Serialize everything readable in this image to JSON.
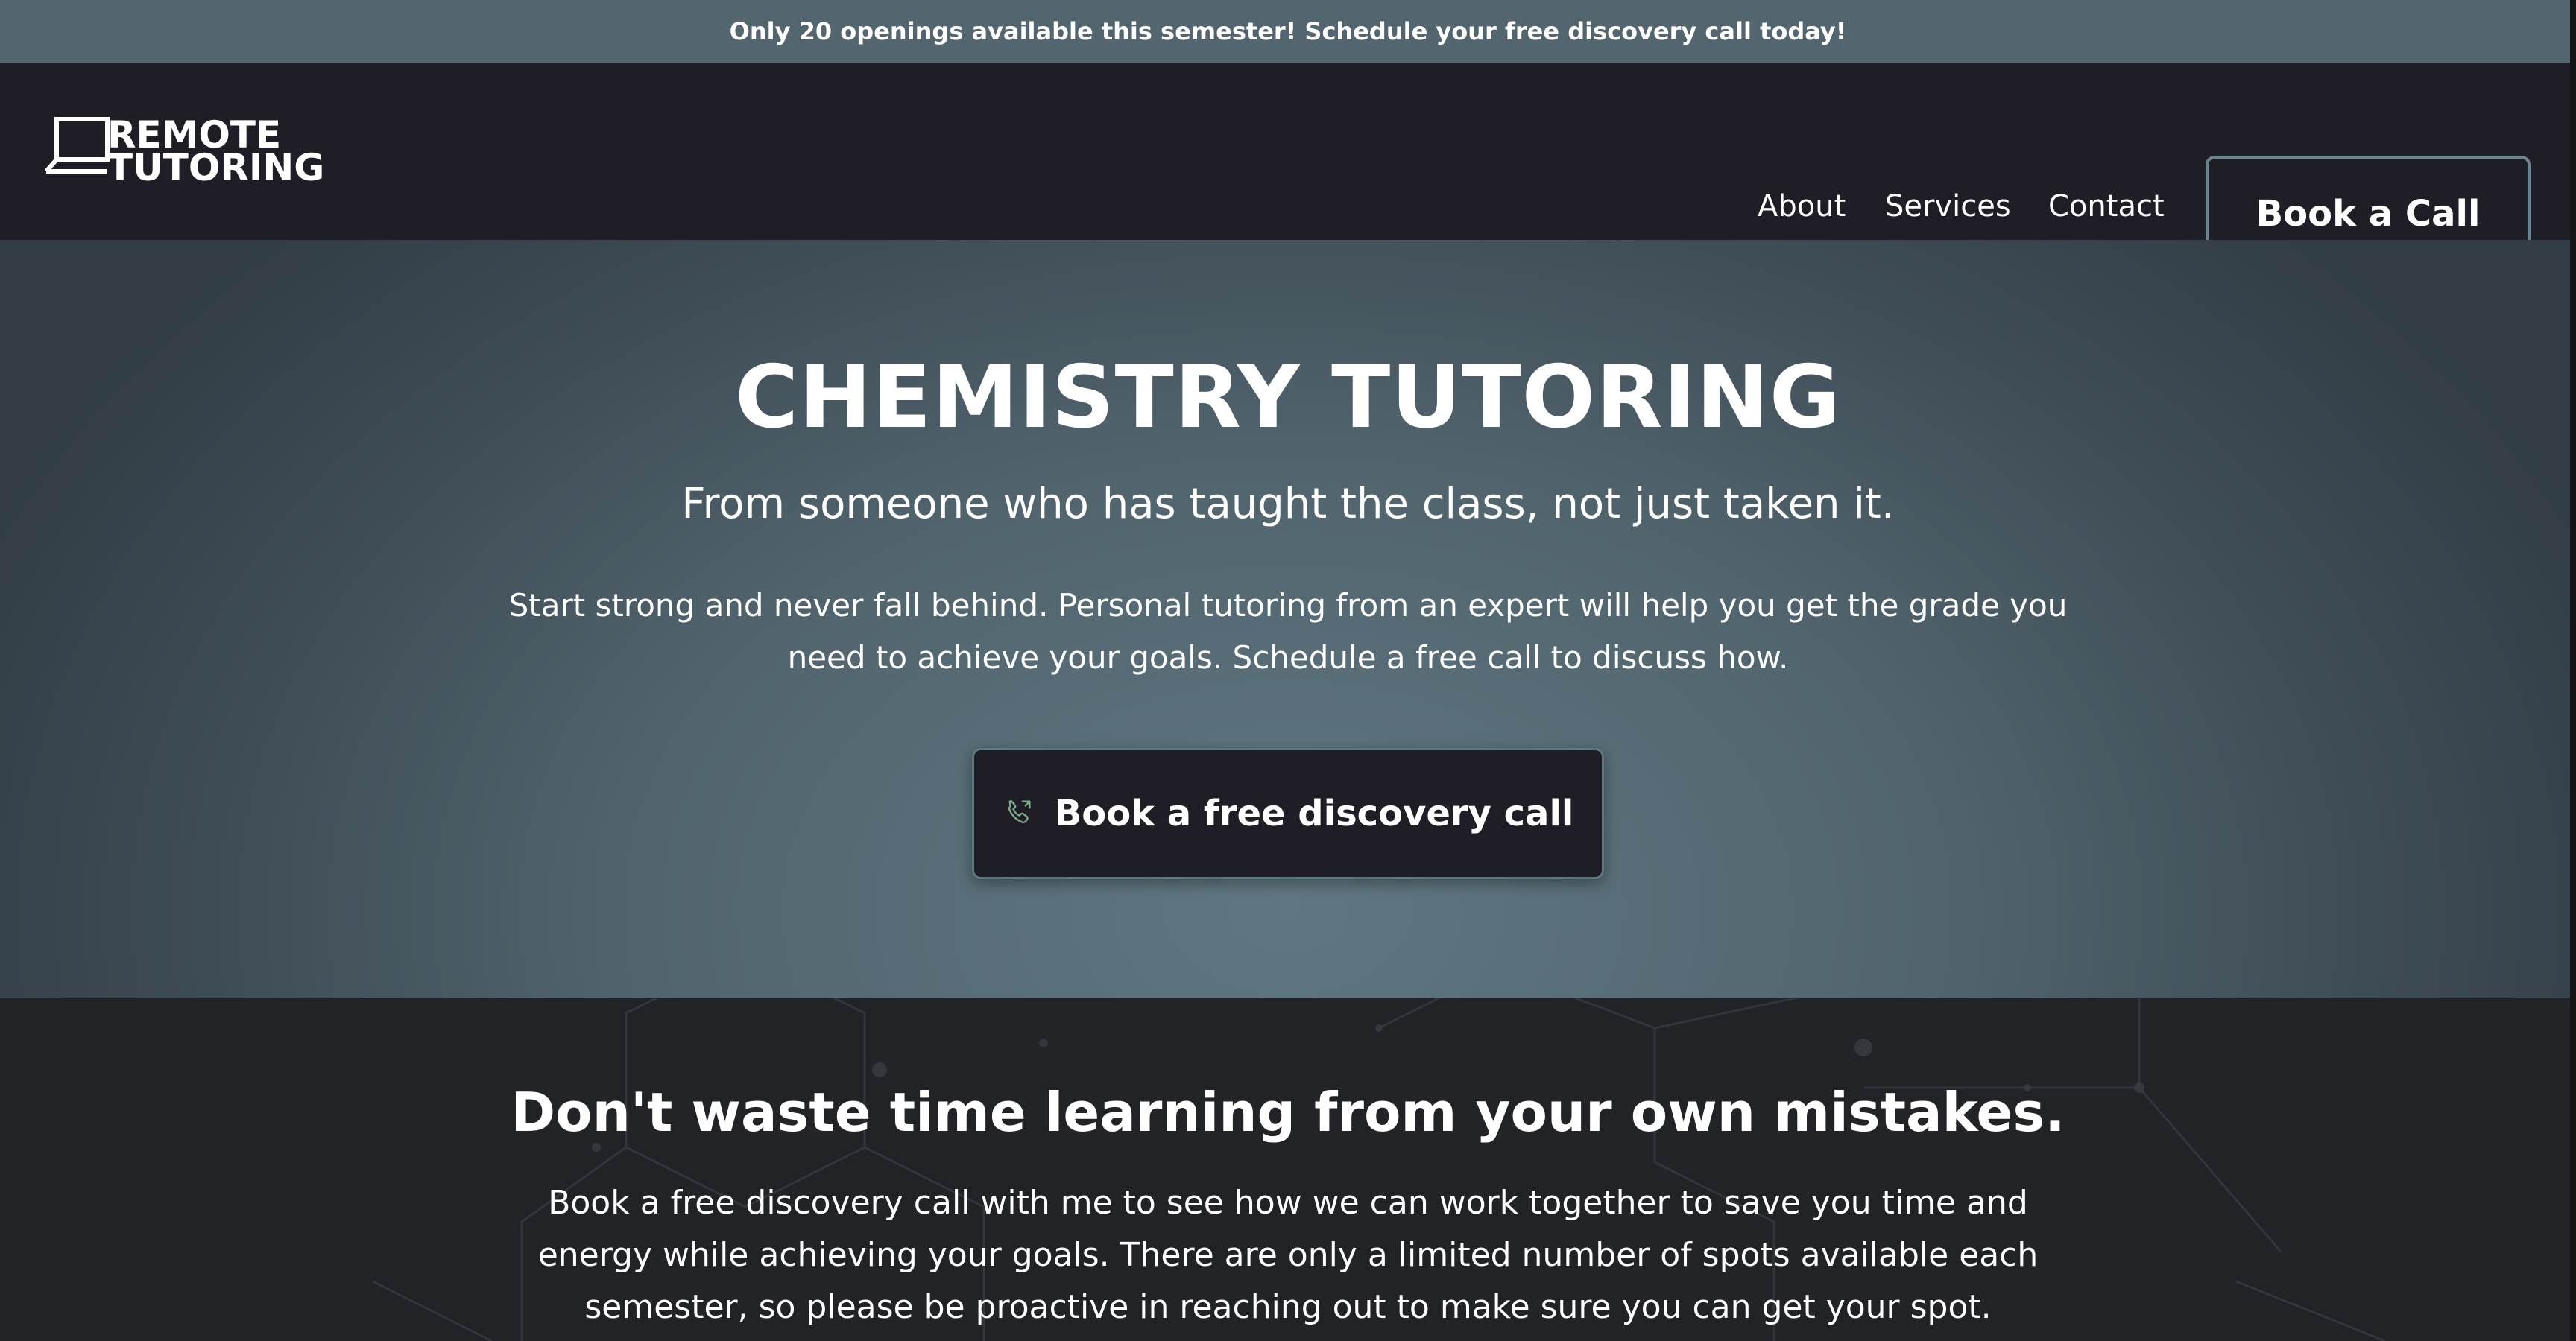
{
  "announcement": {
    "text": "Only 20 openings available this semester! Schedule your free discovery call today!"
  },
  "header": {
    "logo": {
      "line1": "REMOTE",
      "line2": "TUTORING"
    },
    "nav": [
      {
        "label": "About"
      },
      {
        "label": "Services"
      },
      {
        "label": "Contact"
      }
    ],
    "cta_label": "Book a Call"
  },
  "hero": {
    "title": "CHEMISTRY TUTORING",
    "subtitle": "From someone who has taught the class, not just taken it.",
    "body": "Start strong and never fall behind. Personal tutoring from an expert will help you get the grade you need to achieve your goals. Schedule a free call to discuss how.",
    "button_label": "Book a free discovery call",
    "button_icon": "phone-icon"
  },
  "section": {
    "title": "Don't waste time learning from your own mistakes.",
    "body": "Book a free discovery call with me to see how we can work together to save you time and energy while achieving your goals. There are only a limited number of spots available each semester, so please be proactive in reaching out to make sure you can get your spot."
  },
  "colors": {
    "announcement_bg": "#53656f",
    "header_bg": "#1f1d25",
    "hero_center": "#5f7781",
    "hero_edge": "#323d45",
    "button_bg": "#1f1d25",
    "button_border": "#6a8590",
    "section_bg": "#212327",
    "text": "#ffffff"
  }
}
